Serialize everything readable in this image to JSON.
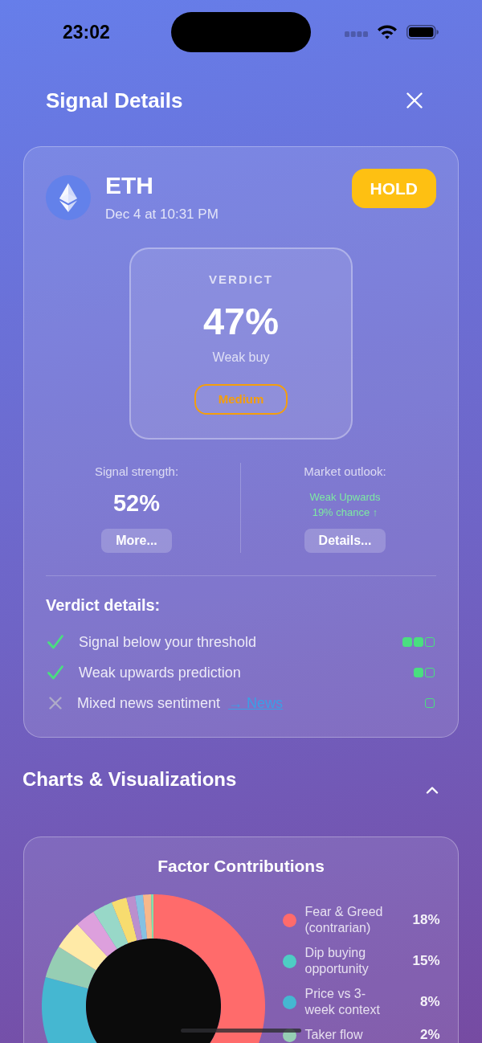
{
  "status_bar": {
    "time": "23:02"
  },
  "header": {
    "title": "Signal Details"
  },
  "signal": {
    "symbol": "ETH",
    "timestamp": "Dec 4 at 10:31 PM",
    "action": "HOLD",
    "verdict": {
      "label": "VERDICT",
      "percent": "47%",
      "description": "Weak buy",
      "confidence": "Medium"
    },
    "strength": {
      "label": "Signal strength:",
      "value": "52%",
      "button": "More..."
    },
    "outlook": {
      "label": "Market outlook:",
      "trend": "Weak Upwards",
      "chance": "19% chance ↑",
      "button": "Details..."
    },
    "verdict_details": {
      "title": "Verdict details:",
      "items": [
        {
          "text": "Signal below your threshold",
          "passed": true,
          "indicators": [
            {
              "filled": true
            },
            {
              "filled": true
            },
            {
              "filled": false
            }
          ]
        },
        {
          "text": "Weak upwards prediction",
          "passed": true,
          "indicators": [
            {
              "filled": true
            },
            {
              "filled": false
            }
          ]
        },
        {
          "text": "Mixed news sentiment",
          "passed": false,
          "link": "→ News",
          "indicators": [
            {
              "filled": false
            }
          ]
        }
      ]
    }
  },
  "charts_section": {
    "title": "Charts & Visualizations",
    "expanded": true,
    "chart": {
      "title": "Factor Contributions",
      "legend": [
        {
          "label": "Fear & Greed (contrarian)",
          "value": "18%",
          "color": "#ff6b6b"
        },
        {
          "label": "Dip buying opportunity",
          "value": "15%",
          "color": "#4ecdc4"
        },
        {
          "label": "Price vs 3-week context",
          "value": "8%",
          "color": "#45b7d1"
        },
        {
          "label": "Taker flow",
          "value": "2%",
          "color": "#96ceb4"
        }
      ]
    }
  }
}
